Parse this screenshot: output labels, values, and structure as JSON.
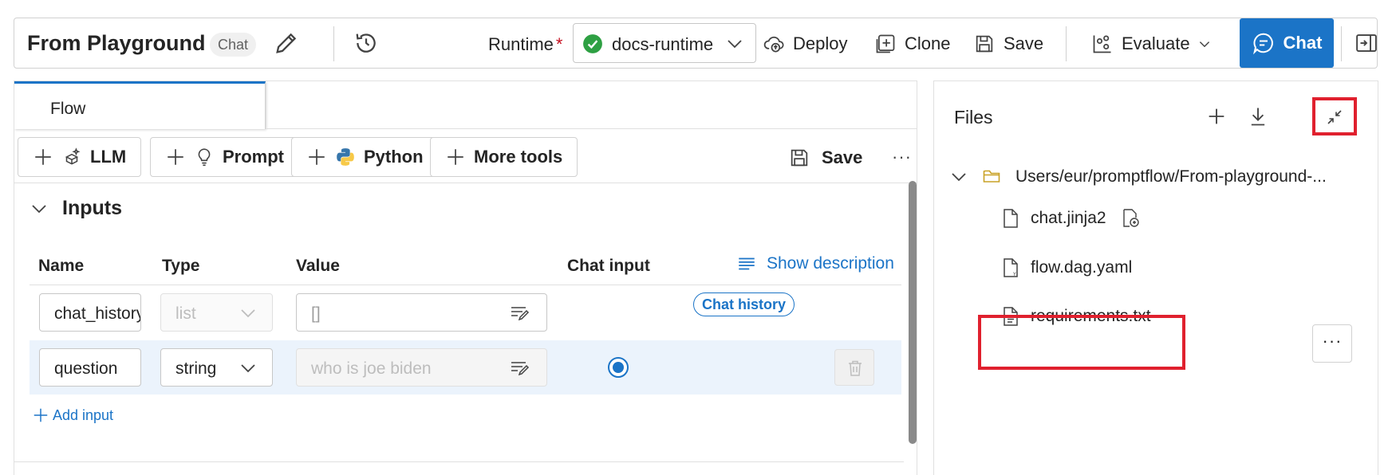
{
  "header": {
    "title": "From Playground",
    "chip": "Chat",
    "runtime_label": "Runtime",
    "runtime_required": "*",
    "runtime_value": "docs-runtime",
    "deploy_label": "Deploy",
    "clone_label": "Clone",
    "save_label": "Save",
    "evaluate_label": "Evaluate",
    "chat_label": "Chat"
  },
  "flow_tab": {
    "label": "Flow"
  },
  "tools": {
    "llm": "LLM",
    "prompt": "Prompt",
    "python": "Python",
    "more_tools": "More tools",
    "save": "Save",
    "more": "···"
  },
  "inputs": {
    "section_title": "Inputs",
    "columns": {
      "name": "Name",
      "type": "Type",
      "value": "Value",
      "chat_input": "Chat input"
    },
    "show_description": "Show description",
    "rows": [
      {
        "name": "chat_history",
        "type": "list",
        "value": "[]",
        "badge": "Chat history"
      },
      {
        "name": "question",
        "type": "string",
        "value_placeholder": "who is joe biden",
        "chat_input_selected": true
      }
    ],
    "add_input": "Add input"
  },
  "files": {
    "title": "Files",
    "root_folder": "Users/eur/promptflow/From-playground-...",
    "items": [
      {
        "name": "chat.jinja2"
      },
      {
        "name": "flow.dag.yaml"
      },
      {
        "name": "requirements.txt"
      }
    ],
    "more": "···"
  },
  "colors": {
    "accent": "#1b74c7",
    "highlight_box": "#e0202e",
    "runtime_ok": "#2ea043",
    "folder": "#c9a227",
    "row_selected_bg": "#ebf3fc"
  }
}
